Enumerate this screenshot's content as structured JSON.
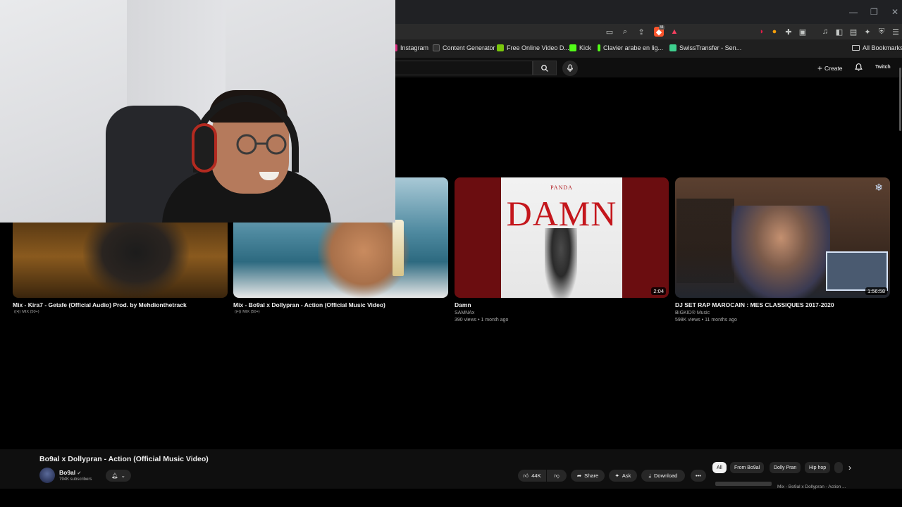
{
  "browser": {
    "extension_badge": "34",
    "bookmarks": [
      {
        "label": "Instagram",
        "color": "#d6297a"
      },
      {
        "label": "Content Generator",
        "color": "#333333"
      },
      {
        "label": "Free Online Video D...",
        "color": "#7ac70c"
      },
      {
        "label": "Kick",
        "color": "#53fc18"
      },
      {
        "label": "Clavier arabe en lig...",
        "color": "#53fc18"
      },
      {
        "label": "SwissTransfer - Sen...",
        "color": "#3ecf8e"
      }
    ],
    "all_bookmarks": "All Bookmarks"
  },
  "youtube": {
    "create_label": "Create",
    "user_label": "Twitch"
  },
  "thumbnail_text": {
    "damn_brand": "PANDA",
    "damn_word": "DAMN"
  },
  "videos": [
    {
      "title": "Mix - Kira7 - Getafe (Official Audio) Prod. by Mehdionthetrack",
      "badge": "MIX (50+)"
    },
    {
      "title": "Mix - Bo9al x Dollypran - Action (Official Music Video)",
      "badge": "MIX (50+)"
    },
    {
      "title": "Damn",
      "channel": "SAMNAx",
      "meta": "390 views • 1 month ago",
      "duration": "2:04"
    },
    {
      "title": "DJ SET RAP MAROCAIN : MES CLASSIQUES 2017-2020",
      "channel": "BIGKID® Music",
      "meta": "598K views • 11 months ago",
      "duration": "1:56:58"
    }
  ],
  "player": {
    "title": "Bo9al x Dollypran - Action (Official Music Video)",
    "channel": "Bo9al",
    "subscribers": "794K subscribers",
    "likes": "44K",
    "share": "Share",
    "ask": "Ask",
    "download": "Download",
    "chips": [
      "All",
      "From Bo9al",
      "Dolly Pran",
      "Hip hop"
    ],
    "next_up": "Mix - Bo9al x Dollypran - Action ..."
  }
}
